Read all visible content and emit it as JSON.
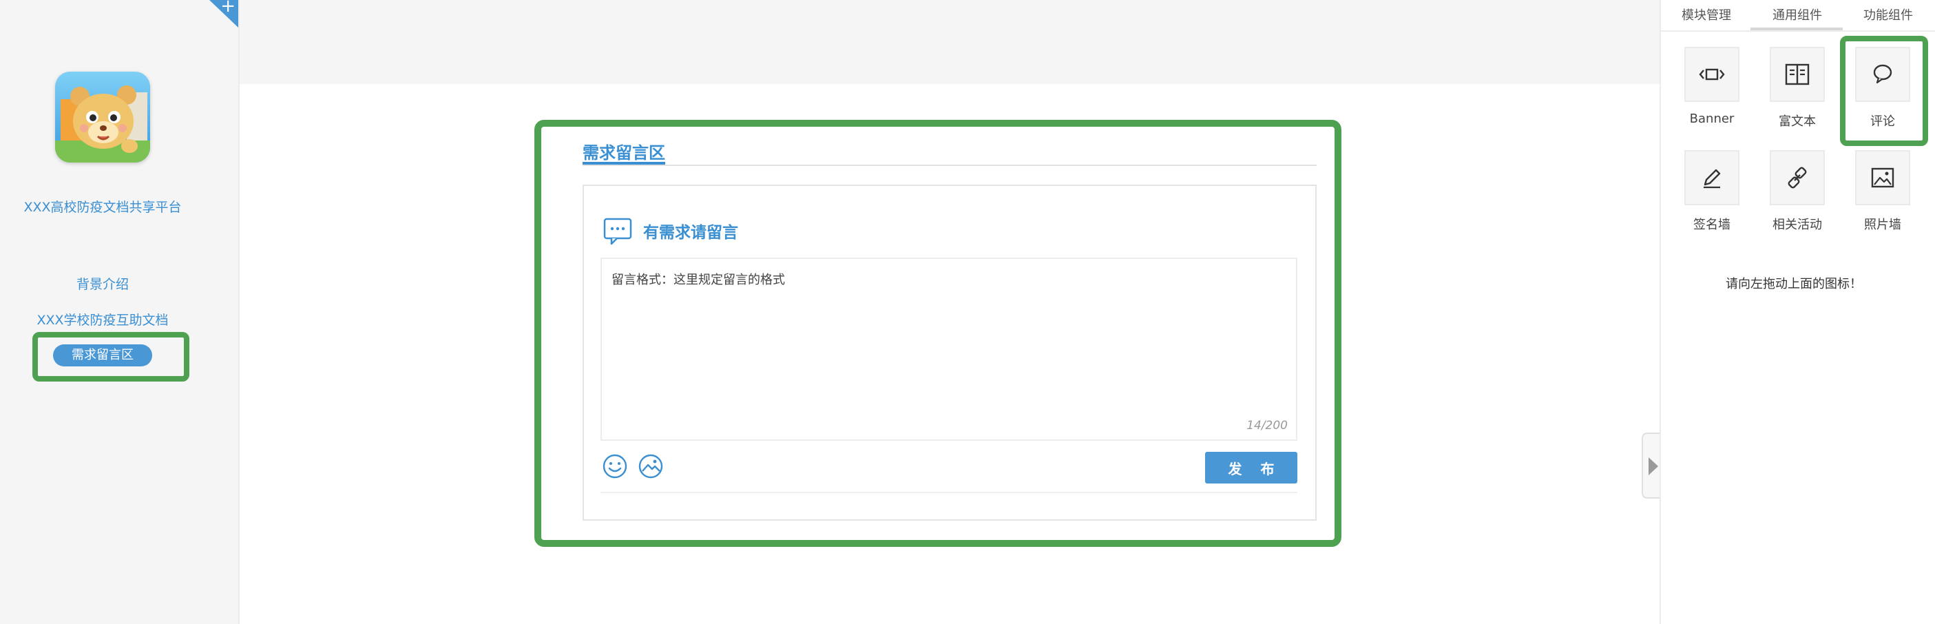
{
  "sidebar": {
    "site_title": "XXX高校防疫文档共享平台",
    "nav": [
      {
        "label": "背景介绍"
      },
      {
        "label": "XXX学校防疫互助文档"
      },
      {
        "label": "需求留言区",
        "active": true
      }
    ]
  },
  "main": {
    "section_title": "需求留言区",
    "comment_box": {
      "title": "有需求请留言",
      "text": "留言格式：这里规定留言的格式",
      "counter": "14/200",
      "publish_label": "发 布"
    }
  },
  "right_panel": {
    "tabs": [
      {
        "label": "模块管理"
      },
      {
        "label": "通用组件",
        "active": true
      },
      {
        "label": "功能组件"
      }
    ],
    "components": [
      {
        "label": "Banner",
        "icon": "banner-icon"
      },
      {
        "label": "富文本",
        "icon": "rich-text-icon"
      },
      {
        "label": "评论",
        "icon": "comment-icon",
        "highlighted": true
      },
      {
        "label": "签名墙",
        "icon": "signature-icon"
      },
      {
        "label": "相关活动",
        "icon": "link-icon"
      },
      {
        "label": "照片墙",
        "icon": "image-icon"
      }
    ],
    "hint": "请向左拖动上面的图标！"
  },
  "colors": {
    "accent": "#4a97d6",
    "highlight_frame": "#4ea150",
    "sidebar_bg": "#f5f5f5"
  }
}
